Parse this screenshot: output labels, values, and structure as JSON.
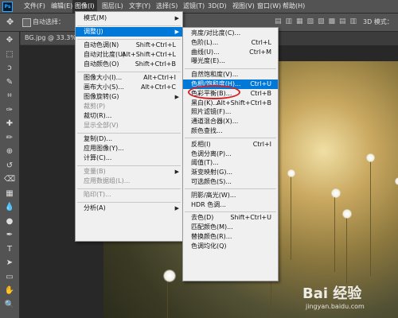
{
  "app_icon": "Ps",
  "menubar": [
    "文件(F)",
    "编辑(E)",
    "图像(I)",
    "图层(L)",
    "文字(Y)",
    "选择(S)",
    "滤镜(T)",
    "3D(D)",
    "视图(V)",
    "窗口(W)",
    "帮助(H)"
  ],
  "options": {
    "auto_select_label": "自动选择：",
    "mode_3d": "3D 模式："
  },
  "tab": {
    "title": "BG.jpg @ 33.3%(RG"
  },
  "image_menu": [
    {
      "label": "模式(M)",
      "shortcut": "",
      "submenu": true,
      "disabled": false
    },
    {
      "sep": true
    },
    {
      "label": "调整(J)",
      "shortcut": "",
      "submenu": true,
      "disabled": false,
      "active": true
    },
    {
      "sep": true
    },
    {
      "label": "自动色调(N)",
      "shortcut": "Shift+Ctrl+L",
      "disabled": false
    },
    {
      "label": "自动对比度(U)",
      "shortcut": "Alt+Shift+Ctrl+L",
      "disabled": false
    },
    {
      "label": "自动颜色(O)",
      "shortcut": "Shift+Ctrl+B",
      "disabled": false
    },
    {
      "sep": true
    },
    {
      "label": "图像大小(I)...",
      "shortcut": "Alt+Ctrl+I",
      "disabled": false
    },
    {
      "label": "画布大小(S)...",
      "shortcut": "Alt+Ctrl+C",
      "disabled": false
    },
    {
      "label": "图像旋转(G)",
      "shortcut": "",
      "submenu": true,
      "disabled": false
    },
    {
      "label": "裁剪(P)",
      "shortcut": "",
      "disabled": true
    },
    {
      "label": "裁切(R)...",
      "shortcut": "",
      "disabled": false
    },
    {
      "label": "显示全部(V)",
      "shortcut": "",
      "disabled": true
    },
    {
      "sep": true
    },
    {
      "label": "复制(D)...",
      "shortcut": "",
      "disabled": false
    },
    {
      "label": "应用图像(Y)...",
      "shortcut": "",
      "disabled": false
    },
    {
      "label": "计算(C)...",
      "shortcut": "",
      "disabled": false
    },
    {
      "sep": true
    },
    {
      "label": "变量(B)",
      "shortcut": "",
      "submenu": true,
      "disabled": true
    },
    {
      "label": "应用数据组(L)...",
      "shortcut": "",
      "disabled": true
    },
    {
      "sep": true
    },
    {
      "label": "陷印(T)...",
      "shortcut": "",
      "disabled": true
    },
    {
      "sep": true
    },
    {
      "label": "分析(A)",
      "shortcut": "",
      "submenu": true,
      "disabled": false
    }
  ],
  "adjust_menu": [
    {
      "label": "亮度/对比度(C)...",
      "shortcut": ""
    },
    {
      "label": "色阶(L)...",
      "shortcut": "Ctrl+L"
    },
    {
      "label": "曲线(U)...",
      "shortcut": "Ctrl+M"
    },
    {
      "label": "曝光度(E)...",
      "shortcut": ""
    },
    {
      "sep": true
    },
    {
      "label": "自然饱和度(V)...",
      "shortcut": ""
    },
    {
      "label": "色相/饱和度(H)...",
      "shortcut": "Ctrl+U",
      "highlight": true
    },
    {
      "label": "色彩平衡(B)...",
      "shortcut": "Ctrl+B"
    },
    {
      "label": "黑白(K)...",
      "shortcut": "Alt+Shift+Ctrl+B"
    },
    {
      "label": "照片滤镜(F)...",
      "shortcut": ""
    },
    {
      "label": "通道混合器(X)...",
      "shortcut": ""
    },
    {
      "label": "颜色查找...",
      "shortcut": ""
    },
    {
      "sep": true
    },
    {
      "label": "反相(I)",
      "shortcut": "Ctrl+I"
    },
    {
      "label": "色调分离(P)...",
      "shortcut": ""
    },
    {
      "label": "阈值(T)...",
      "shortcut": ""
    },
    {
      "label": "渐变映射(G)...",
      "shortcut": ""
    },
    {
      "label": "可选颜色(S)...",
      "shortcut": ""
    },
    {
      "sep": true
    },
    {
      "label": "阴影/高光(W)...",
      "shortcut": ""
    },
    {
      "label": "HDR 色调...",
      "shortcut": ""
    },
    {
      "sep": true
    },
    {
      "label": "去色(D)",
      "shortcut": "Shift+Ctrl+U"
    },
    {
      "label": "匹配颜色(M)...",
      "shortcut": ""
    },
    {
      "label": "替换颜色(R)...",
      "shortcut": ""
    },
    {
      "label": "色调均化(Q)",
      "shortcut": ""
    }
  ],
  "tools": [
    "move-tool",
    "marquee-tool",
    "lasso-tool",
    "quick-select-tool",
    "crop-tool",
    "eyedropper-tool",
    "healing-tool",
    "brush-tool",
    "stamp-tool",
    "history-brush-tool",
    "eraser-tool",
    "gradient-tool",
    "blur-tool",
    "dodge-tool",
    "pen-tool",
    "type-tool",
    "path-select-tool",
    "rectangle-tool",
    "hand-tool",
    "zoom-tool"
  ],
  "watermark": {
    "brand": "Bai 经验",
    "url": "jingyan.baidu.com"
  },
  "colors": {
    "highlight": "#0078d7",
    "oval": "#d2232a",
    "menu_bg": "#f0f0f0",
    "chrome": "#535353"
  }
}
